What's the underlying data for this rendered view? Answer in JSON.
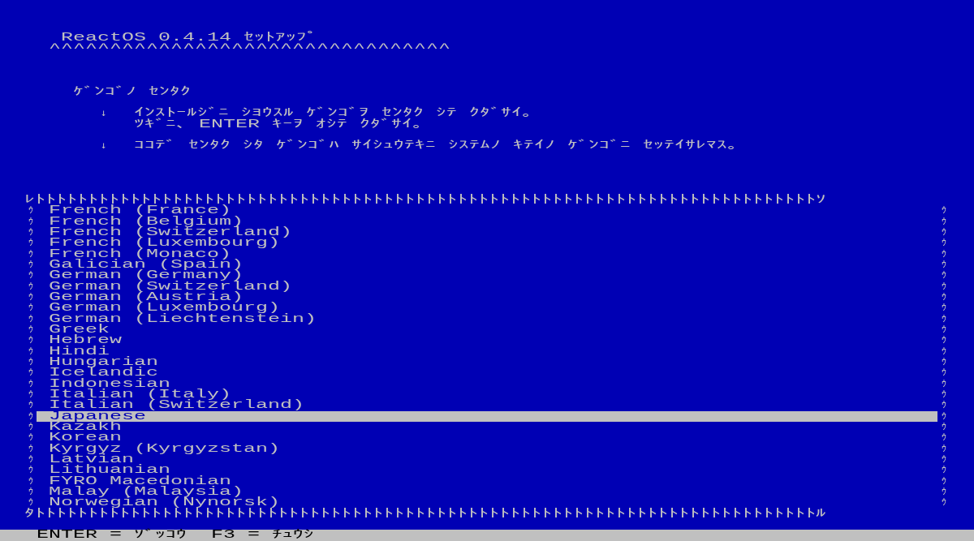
{
  "title": "ReactOS 0.4.14 ｾｯﾄｱｯﾌﾟ",
  "title_underline": "^^^^^^^^^^^^^^^^^^^^^^^^^^^^^^^^^",
  "heading": "ｹﾞﾝｺﾞﾉ ｾﾝﾀｸ",
  "instructions": [
    {
      "marker": "↓",
      "lines": [
        "ｲﾝｽﾄｰﾙｼﾞﾆ ｼﾖｳｽﾙ ｹﾞﾝｺﾞｦ ｾﾝﾀｸ ｼﾃ ｸﾀﾞｻｲ｡",
        "ﾂｷﾞﾆ､ ENTER ｷｰｦ ｵｼﾃ ｸﾀﾞｻｲ｡"
      ]
    },
    {
      "marker": "↓",
      "lines": [
        "ｺｺﾃﾞ ｾﾝﾀｸ ｼﾀ ｹﾞﾝｺﾞﾊ ｻｲｼｭｳﾃｷﾆ ｼｽﾃﾑﾉ ｷﾃｲﾉ ｹﾞﾝｺﾞﾆ ｾｯﾃｲｻﾚﾏｽ｡"
      ]
    }
  ],
  "frame": {
    "top": "ﾚﾄﾄﾄﾄﾄﾄﾄﾄﾄﾄﾄﾄﾄﾄﾄﾄﾄﾄﾄﾄﾄﾄﾄﾄﾄﾄﾄﾄﾄﾄﾄﾄﾄﾄﾄﾄﾄﾄﾄﾄﾄﾄﾄﾄﾄﾄﾄﾄﾄﾄﾄﾄﾄﾄﾄﾄﾄﾄﾄﾄﾄﾄﾄﾄﾄﾄﾄﾄﾄﾄﾄﾄﾄﾄｿ",
    "left": "ｳｳｳｳｳｳｳｳｳｳｳｳｳｳｳｳｳｳｳｳｳｳｳｳｳｳｳｳ",
    "right": "ｳｳｳｳｳｳｳｳｳｳｳｳｳｳｳｳｳｳｳｳｳｳｳｳｳｳｳｳ",
    "bottom": "ﾀﾄﾄﾄﾄﾄﾄﾄﾄﾄﾄﾄﾄﾄﾄﾄﾄﾄﾄﾄﾄﾄﾄﾄﾄﾄﾄﾄﾄﾄﾄﾄﾄﾄﾄﾄﾄﾄﾄﾄﾄﾄﾄﾄﾄﾄﾄﾄﾄﾄﾄﾄﾄﾄﾄﾄﾄﾄﾄﾄﾄﾄﾄﾄﾄﾄﾄﾄﾄﾄﾄﾄﾄﾄﾄﾙ"
  },
  "languages": [
    {
      "label": "French (France)",
      "selected": false
    },
    {
      "label": "French (Belgium)",
      "selected": false
    },
    {
      "label": "French (Switzerland)",
      "selected": false
    },
    {
      "label": "French (Luxembourg)",
      "selected": false
    },
    {
      "label": "French (Monaco)",
      "selected": false
    },
    {
      "label": "Galician (Spain)",
      "selected": false
    },
    {
      "label": "German (Germany)",
      "selected": false
    },
    {
      "label": "German (Switzerland)",
      "selected": false
    },
    {
      "label": "German (Austria)",
      "selected": false
    },
    {
      "label": "German (Luxembourg)",
      "selected": false
    },
    {
      "label": "German (Liechtenstein)",
      "selected": false
    },
    {
      "label": "Greek",
      "selected": false
    },
    {
      "label": "Hebrew",
      "selected": false
    },
    {
      "label": "Hindi",
      "selected": false
    },
    {
      "label": "Hungarian",
      "selected": false
    },
    {
      "label": "Icelandic",
      "selected": false
    },
    {
      "label": "Indonesian",
      "selected": false
    },
    {
      "label": "Italian (Italy)",
      "selected": false
    },
    {
      "label": "Italian (Switzerland)",
      "selected": false
    },
    {
      "label": "Japanese",
      "selected": true
    },
    {
      "label": "Kazakh",
      "selected": false
    },
    {
      "label": "Korean",
      "selected": false
    },
    {
      "label": "Kyrgyz (Kyrgyzstan)",
      "selected": false
    },
    {
      "label": "Latvian",
      "selected": false
    },
    {
      "label": "Lithuanian",
      "selected": false
    },
    {
      "label": "FYRO Macedonian",
      "selected": false
    },
    {
      "label": "Malay (Malaysia)",
      "selected": false
    },
    {
      "label": "Norwegian (Nynorsk)",
      "selected": false
    }
  ],
  "status_bar": "ENTER = ｿﾞｯｺｳ  F3 = ﾁｭｳｼ"
}
